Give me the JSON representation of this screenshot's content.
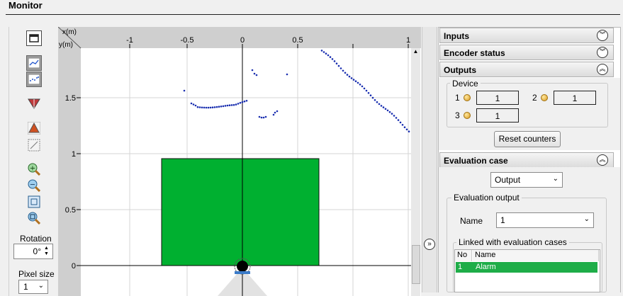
{
  "window": {
    "title": "Monitor"
  },
  "toolbar": {
    "rotation_label": "Rotation",
    "rotation_value": "0°",
    "pixel_size_label": "Pixel size",
    "pixel_size_value": "1"
  },
  "plot": {
    "x_axis_label": "x(m)",
    "y_axis_label": "y(m)",
    "x_ticks": [
      "-1",
      "-0.5",
      "0",
      "0.5",
      "1"
    ],
    "y_ticks": [
      "1.5",
      "1",
      "0.5",
      "0"
    ],
    "field_color": "#00b030"
  },
  "panel": {
    "inputs_header": "Inputs",
    "encoder_header": "Encoder status",
    "outputs_header": "Outputs",
    "device_group": "Device",
    "devices": [
      {
        "num": "1",
        "value": "1"
      },
      {
        "num": "2",
        "value": "1"
      },
      {
        "num": "3",
        "value": "1"
      }
    ],
    "reset_button": "Reset counters",
    "evaluation_header": "Evaluation case",
    "evaluation_select": "Output",
    "evaluation_output_group": "Evaluation output",
    "name_label": "Name",
    "name_value": "1",
    "linked_group": "Linked with evaluation cases",
    "table_headers": [
      "No",
      "Name"
    ],
    "table_rows": [
      {
        "no": "1",
        "name": "Alarm"
      }
    ]
  }
}
